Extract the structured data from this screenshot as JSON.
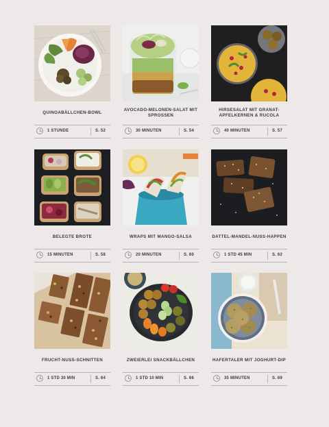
{
  "recipes": [
    {
      "title": "QUINOABÄLLCHEN-BOWL",
      "time": "1 STUNDE",
      "page": "S. 52",
      "photo_icon": "quinoa-bowl-photo"
    },
    {
      "title": "AVOCADO-MELONEN-SALAT MIT SPROSSEN",
      "time": "30 MINUTEN",
      "page": "S. 54",
      "photo_icon": "salad-jar-photo"
    },
    {
      "title": "HIRSESALAT MIT GRANAT-APFELKERNEN & RUCOLA",
      "time": "40 MINUTEN",
      "page": "S. 57",
      "photo_icon": "millet-salad-photo"
    },
    {
      "title": "BELEGTE BROTE",
      "time": "15 MINUTEN",
      "page": "S. 58",
      "photo_icon": "open-sandwiches-photo"
    },
    {
      "title": "WRAPS MIT MANGO-SALSA",
      "time": "20 MINUTEN",
      "page": "S. 60",
      "photo_icon": "wraps-photo"
    },
    {
      "title": "DATTEL-MANDEL-NUSS-HAPPEN",
      "time": "1 STD 45 MIN",
      "page": "S. 62",
      "photo_icon": "date-bars-photo"
    },
    {
      "title": "FRUCHT-NUSS-SCHNITTEN",
      "time": "1 STD 30 MIN",
      "page": "S. 64",
      "photo_icon": "fruit-nut-slices-photo"
    },
    {
      "title": "ZWEIERLEI SNACKBÄLLCHEN",
      "time": "1 STD 10 MIN",
      "page": "S. 66",
      "photo_icon": "snack-balls-photo"
    },
    {
      "title": "HAFERTALER MIT JOGHURT-DIP",
      "time": "35 MINUTEN",
      "page": "S. 69",
      "photo_icon": "oat-patties-photo"
    }
  ],
  "colors": {
    "background": "#ede9e8",
    "text": "#3a3a3a",
    "rule": "#b9b3b1",
    "icon": "#9c9593"
  }
}
